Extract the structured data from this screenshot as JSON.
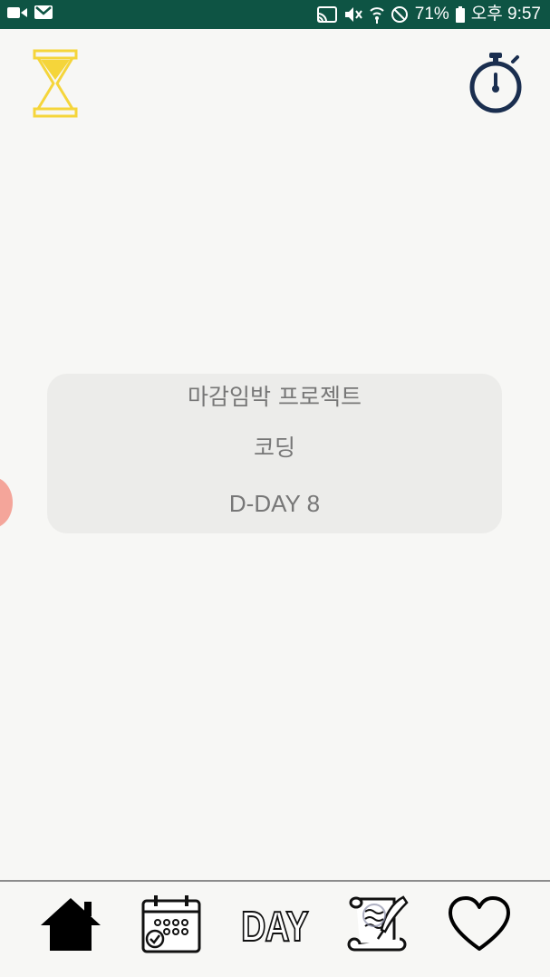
{
  "status_bar": {
    "battery_percent": "71%",
    "time": "오후 9:57",
    "icons": [
      "video-icon",
      "gmail-icon",
      "cast-icon",
      "mute-icon",
      "wifi-icon",
      "do-not-disturb-icon",
      "battery-icon"
    ]
  },
  "header": {
    "left_icon": "hourglass-icon",
    "right_icon": "stopwatch-icon"
  },
  "card": {
    "title": "마감임박 프로젝트",
    "subtitle": "코딩",
    "dday": "D-DAY 8"
  },
  "bottom_nav": {
    "items": [
      {
        "name": "home",
        "icon": "home-icon"
      },
      {
        "name": "calendar",
        "icon": "calendar-check-icon"
      },
      {
        "name": "day",
        "label": "DAY"
      },
      {
        "name": "diary",
        "icon": "scroll-quill-icon"
      },
      {
        "name": "favorites",
        "icon": "heart-icon"
      }
    ]
  },
  "colors": {
    "status_bar": "#0e5444",
    "hourglass": "#f5d53a",
    "stopwatch": "#1a2e4f",
    "card_bg": "#ececea",
    "card_text": "#777777",
    "side_dot": "#f4a59a"
  }
}
